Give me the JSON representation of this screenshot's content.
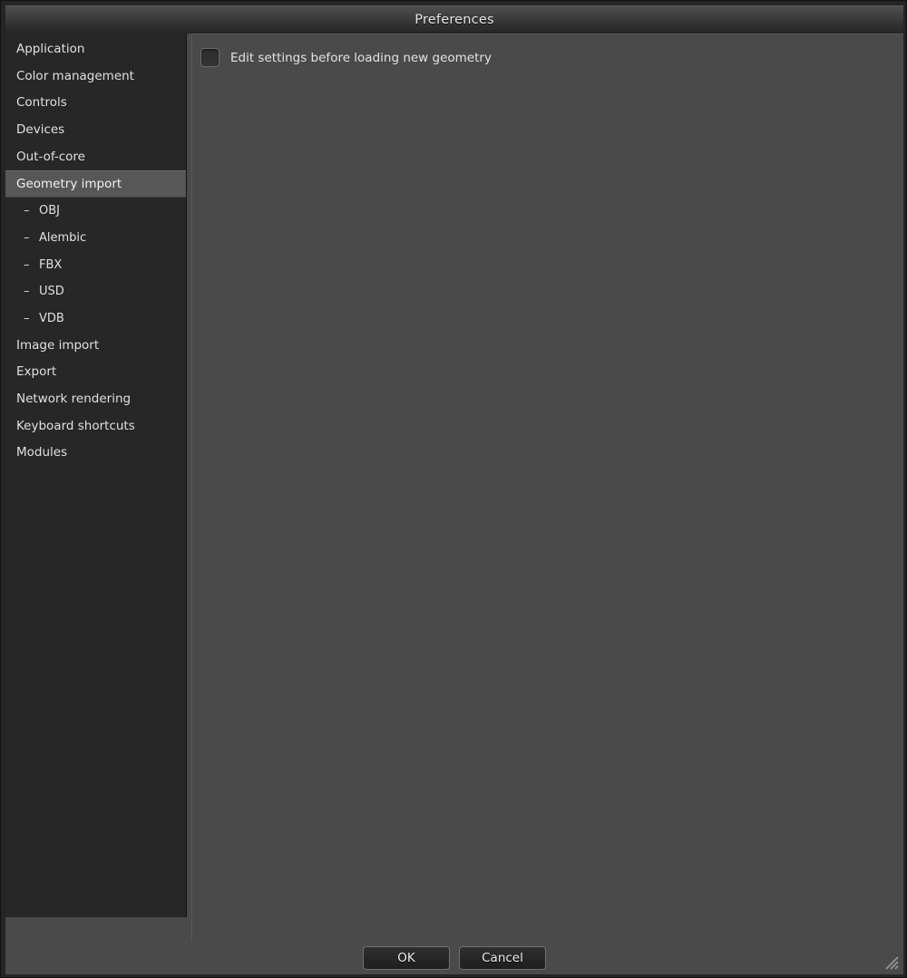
{
  "window": {
    "title": "Preferences"
  },
  "sidebar": {
    "items": [
      {
        "label": "Application",
        "level": 0,
        "selected": false
      },
      {
        "label": "Color management",
        "level": 0,
        "selected": false
      },
      {
        "label": "Controls",
        "level": 0,
        "selected": false
      },
      {
        "label": "Devices",
        "level": 0,
        "selected": false
      },
      {
        "label": "Out-of-core",
        "level": 0,
        "selected": false
      },
      {
        "label": "Geometry import",
        "level": 0,
        "selected": true
      },
      {
        "label": "OBJ",
        "level": 1,
        "selected": false
      },
      {
        "label": "Alembic",
        "level": 1,
        "selected": false
      },
      {
        "label": "FBX",
        "level": 1,
        "selected": false
      },
      {
        "label": "USD",
        "level": 1,
        "selected": false
      },
      {
        "label": "VDB",
        "level": 1,
        "selected": false
      },
      {
        "label": "Image import",
        "level": 0,
        "selected": false
      },
      {
        "label": "Export",
        "level": 0,
        "selected": false
      },
      {
        "label": "Network rendering",
        "level": 0,
        "selected": false
      },
      {
        "label": "Keyboard shortcuts",
        "level": 0,
        "selected": false
      },
      {
        "label": "Modules",
        "level": 0,
        "selected": false
      }
    ],
    "sub_item_marker": "–"
  },
  "main": {
    "settings": [
      {
        "type": "checkbox",
        "label": "Edit settings before loading new geometry",
        "checked": false
      }
    ]
  },
  "footer": {
    "ok_label": "OK",
    "cancel_label": "Cancel"
  },
  "icons": {
    "resize_grip": "resize-grip-icon"
  },
  "colors": {
    "window_background": "#252525",
    "titlebar_top": "#4e4e4e",
    "titlebar_bottom": "#262626",
    "sidebar_background": "#272727",
    "sidebar_selected": "#575757",
    "panel_background": "#4a4a4a",
    "text_primary": "#e3e3e3",
    "button_border": "#707070"
  }
}
